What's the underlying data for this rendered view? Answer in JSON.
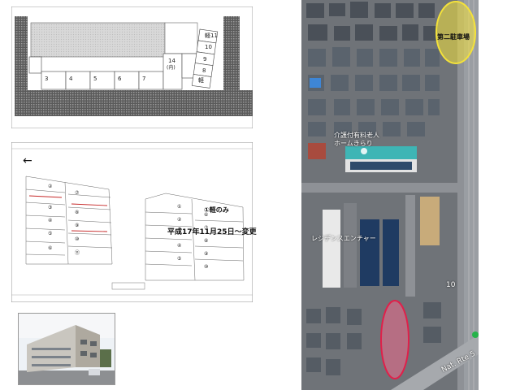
{
  "left_panel": {
    "parking_plan": {
      "numbers": [
        "3",
        "4",
        "5",
        "6",
        "7"
      ],
      "center_number": "14",
      "center_sub": "(内)",
      "right_number_top": "軽11",
      "right_number_mid": "10",
      "right_numbers_lower": [
        "9",
        "8"
      ],
      "light_label": "軽"
    },
    "survey": {
      "direction_arrow": "←",
      "left_lot_numbers": [
        "②",
        "③",
        "④",
        "⑤",
        "⑥",
        "⑦",
        "⑧",
        "⑨",
        "⑩",
        "⑪"
      ],
      "right_lot_numbers": [
        "①",
        "②",
        "③",
        "④",
        "⑤",
        "⑥",
        "⑦",
        "⑧",
        "⑨",
        "⑩"
      ],
      "note_light_only": "①軽のみ",
      "date_change_note": "平成17年11月25日～変更"
    },
    "photo": {}
  },
  "right_panel": {
    "second_parking_label": "第二駐車場",
    "facility_label_line1": "介護付有料老人",
    "facility_label_line2": "ホームきらり",
    "building_label": "レジデンスエンチャー",
    "route_number": "10",
    "road_label": "Nat. Rte 5",
    "colors": {
      "yellow_marker": "#f4e23a",
      "pink_marker": "#f06a8c",
      "green_dot": "#26b34a"
    }
  }
}
